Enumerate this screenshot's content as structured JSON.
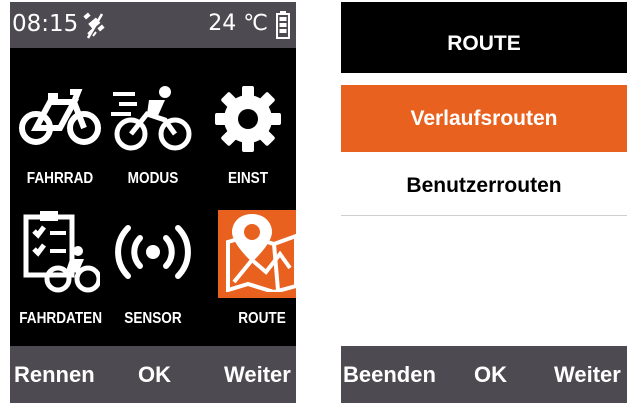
{
  "main_menu": {
    "status": {
      "time": "08:15",
      "temperature": "24 ℃",
      "gps_icon": "gps-off-icon",
      "battery_icon": "battery-icon"
    },
    "tiles": [
      {
        "label": "FAHRRAD",
        "icon": "bicycle-icon"
      },
      {
        "label": "MODUS",
        "icon": "cyclist-speed-icon"
      },
      {
        "label": "EINST",
        "icon": "gear-icon"
      },
      {
        "label": "FAHRDATEN",
        "icon": "ride-data-clipboard-icon"
      },
      {
        "label": "SENSOR",
        "icon": "sensor-signal-icon"
      },
      {
        "label": "ROUTE",
        "icon": "route-map-icon",
        "selected": true
      }
    ],
    "buttons": {
      "left": "Rennen",
      "center": "OK",
      "right": "Weiter"
    }
  },
  "route_menu": {
    "title": "ROUTE",
    "items": [
      {
        "label": "Verlaufsrouten",
        "selected": true
      },
      {
        "label": "Benutzerrouten",
        "selected": false
      }
    ],
    "buttons": {
      "left": "Beenden",
      "center": "OK",
      "right": "Weiter"
    }
  },
  "colors": {
    "accent": "#e8611f",
    "bar": "#4d4b51",
    "screen_bg": "#000000"
  }
}
